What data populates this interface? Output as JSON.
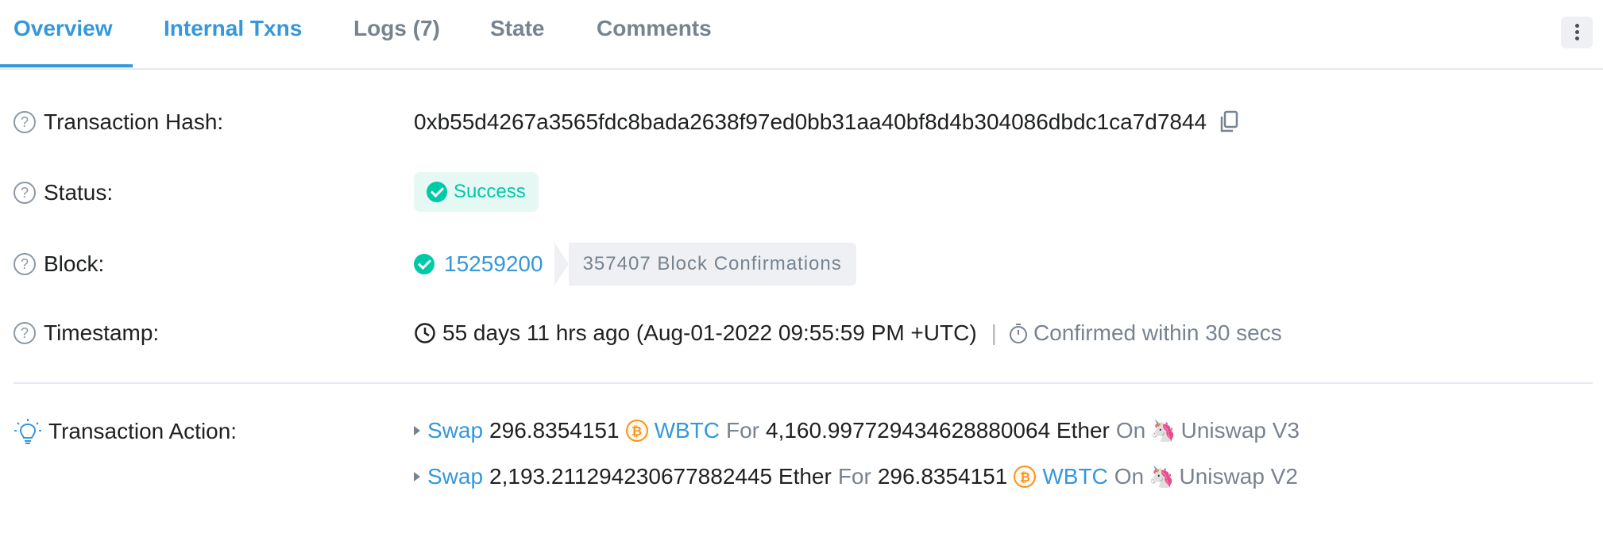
{
  "tabs": [
    {
      "label": "Overview"
    },
    {
      "label": "Internal Txns"
    },
    {
      "label": "Logs (7)"
    },
    {
      "label": "State"
    },
    {
      "label": "Comments"
    }
  ],
  "colors": {
    "accent": "#3498db",
    "success": "#00c9a7",
    "muted": "#77838f",
    "text": "#1e2022"
  },
  "hash": {
    "label": "Transaction Hash:",
    "value": "0xb55d4267a3565fdc8bada2638f97ed0bb31aa40bf8d4b304086dbdc1ca7d7844"
  },
  "status": {
    "label": "Status:",
    "value": "Success"
  },
  "block": {
    "label": "Block:",
    "number": "15259200",
    "confirmations": "357407 Block Confirmations"
  },
  "timestamp": {
    "label": "Timestamp:",
    "value": "55 days 11 hrs ago (Aug-01-2022 09:55:59 PM +UTC)",
    "separator": "|",
    "confirmed": "Confirmed within 30 secs"
  },
  "action": {
    "label": "Transaction Action:",
    "items": [
      {
        "verb": "Swap",
        "amount_in": "296.8354151",
        "token_in": "WBTC",
        "for_word": "For",
        "amount_out": "4,160.997729434628880064 Ether",
        "on_word": "On",
        "venue": "Uniswap V3"
      },
      {
        "verb": "Swap",
        "amount_in": "2,193.211294230677882445 Ether",
        "for_word": "For",
        "amount_out": "296.8354151",
        "token_out": "WBTC",
        "on_word": "On",
        "venue": "Uniswap V2"
      }
    ]
  }
}
